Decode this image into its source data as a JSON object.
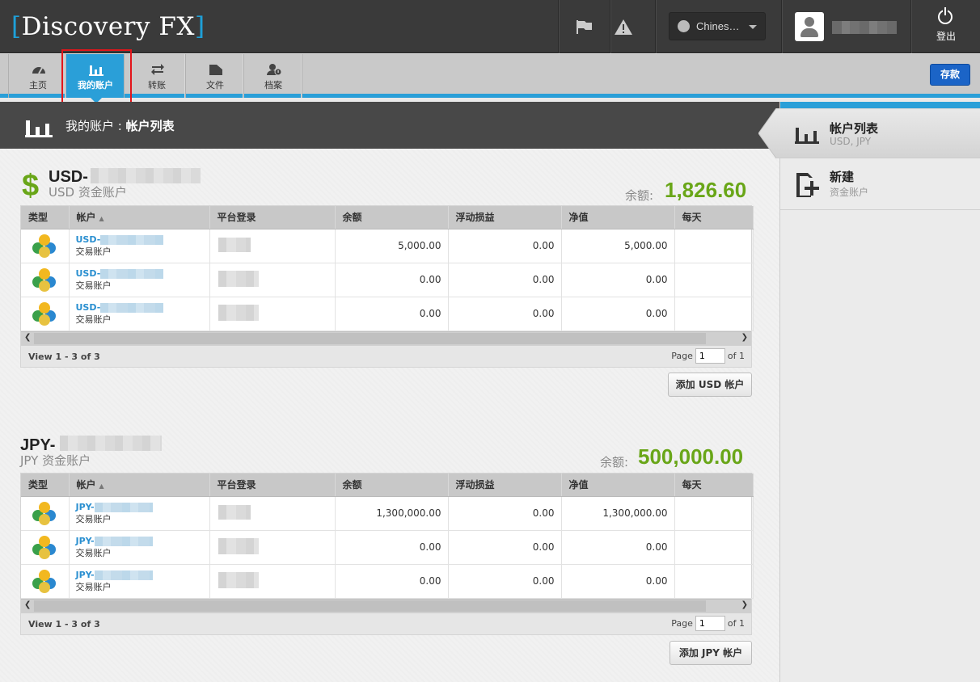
{
  "app": {
    "logo_name": "Discovery FX",
    "logo_left_bracket": "[",
    "logo_right_bracket": "]"
  },
  "topbar": {
    "language": "Chines…",
    "logout_label": "登出"
  },
  "nav": {
    "items": [
      {
        "label": "主页",
        "icon": "dashboard-icon"
      },
      {
        "label": "我的账户",
        "icon": "bar-chart-icon"
      },
      {
        "label": "转账",
        "icon": "transfer-arrows-icon"
      },
      {
        "label": "文件",
        "icon": "folder-icon"
      },
      {
        "label": "档案",
        "icon": "profile-icon"
      }
    ],
    "active_index": 1,
    "deposit_label": "存款"
  },
  "page_header": {
    "prefix": "我的账户 : ",
    "title": "帐户列表"
  },
  "columns": [
    "类型",
    "帐户",
    "平台登录",
    "余额",
    "浮动损益",
    "净值",
    "每天"
  ],
  "usd": {
    "title": "USD-",
    "subtitle": "USD 资金账户",
    "balance_label": "余额:",
    "balance_value": "1,826.60",
    "rows": [
      {
        "account": "USD-",
        "type": "交易账户",
        "balance": "5,000.00",
        "floating": "0.00",
        "equity": "5,000.00"
      },
      {
        "account": "USD-",
        "type": "交易账户",
        "balance": "0.00",
        "floating": "0.00",
        "equity": "0.00"
      },
      {
        "account": "USD-",
        "type": "交易账户",
        "balance": "0.00",
        "floating": "0.00",
        "equity": "0.00"
      }
    ],
    "view_text": "View 1 - 3 of 3",
    "page_label": "Page",
    "page_value": "1",
    "page_of": "of 1",
    "add_label": "添加 USD 帐户"
  },
  "jpy": {
    "title": "JPY-",
    "subtitle": "JPY 资金账户",
    "balance_label": "余额:",
    "balance_value": "500,000.00",
    "rows": [
      {
        "account": "JPY-",
        "type": "交易账户",
        "balance": "1,300,000.00",
        "floating": "0.00",
        "equity": "1,300,000.00"
      },
      {
        "account": "JPY-",
        "type": "交易账户",
        "balance": "0.00",
        "floating": "0.00",
        "equity": "0.00"
      },
      {
        "account": "JPY-",
        "type": "交易账户",
        "balance": "0.00",
        "floating": "0.00",
        "equity": "0.00"
      }
    ],
    "view_text": "View 1 - 3 of 3",
    "page_label": "Page",
    "page_value": "1",
    "page_of": "of 1",
    "add_label": "添加 JPY 帐户"
  },
  "sidebar": {
    "items": [
      {
        "title": "帐户列表",
        "subtitle": "USD, JPY",
        "icon": "bar-chart-icon"
      },
      {
        "title": "新建",
        "subtitle": "资金账户",
        "icon": "new-document-icon"
      }
    ]
  },
  "colors": {
    "accent": "#2a9fd8",
    "balance_green": "#69a618",
    "deposit_blue": "#1b64c7",
    "topbar": "#3a3a3a"
  }
}
